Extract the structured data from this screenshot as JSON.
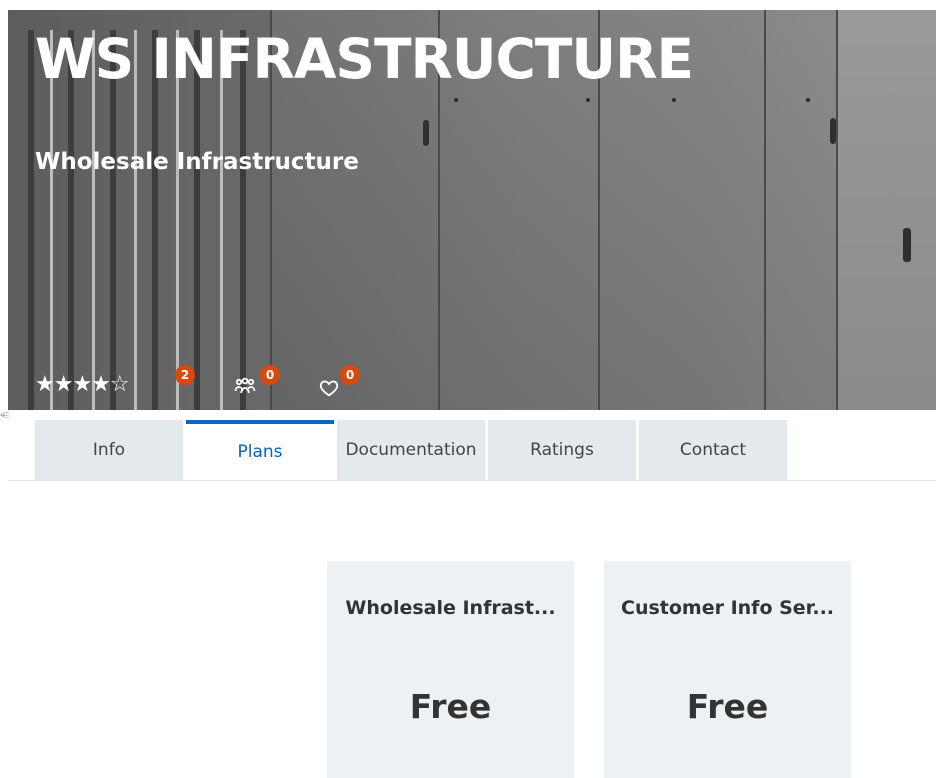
{
  "hero": {
    "title": "WS INFRASTRUCTURE",
    "subtitle": "Wholesale Infrastructure"
  },
  "stats": {
    "rating": 4,
    "rating_max": 5,
    "stars_glyphs": "★★★★☆",
    "rating_count": "2",
    "subscribers_count": "0",
    "followers_count": "0"
  },
  "left_mark": "⥺",
  "tabs": [
    {
      "label": "Info",
      "active": false
    },
    {
      "label": "Plans",
      "active": true
    },
    {
      "label": "Documentation",
      "active": false
    },
    {
      "label": "Ratings",
      "active": false
    },
    {
      "label": "Contact",
      "active": false
    }
  ],
  "plans": [
    {
      "name": "Wholesale Infrast...",
      "price": "Free"
    },
    {
      "name": "Customer Info Ser...",
      "price": "Free"
    }
  ],
  "colors": {
    "accent": "#0a66c2",
    "badge": "#d9480f",
    "tab_bg": "#e4e9ec",
    "card_bg": "#edf1f3"
  },
  "icons": {
    "rating": "star-icon",
    "subscribers": "users-group-icon",
    "followers": "heart-icon"
  }
}
